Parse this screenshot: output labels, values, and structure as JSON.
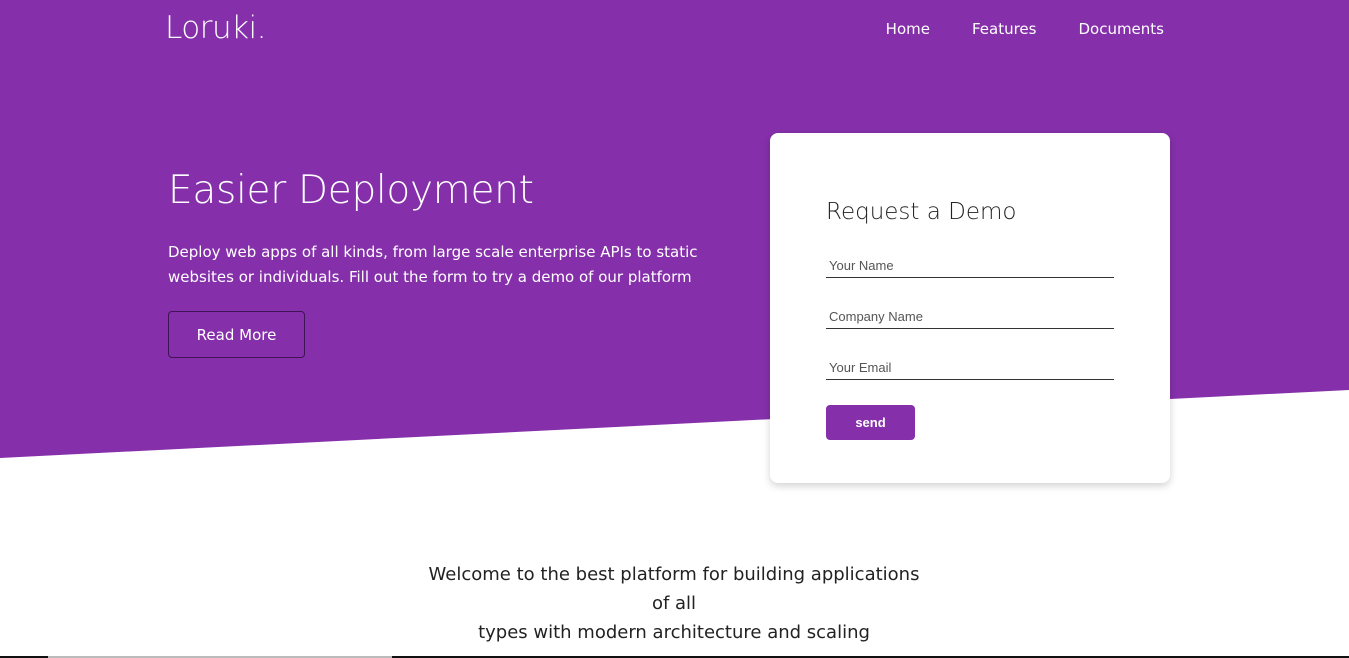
{
  "brand": {
    "logo": "Loruki."
  },
  "nav": {
    "items": [
      "Home",
      "Features",
      "Documents"
    ]
  },
  "hero": {
    "title": "Easier Deployment",
    "text": "Deploy web apps of all kinds, from large scale enterprise APIs to static websites or individuals. Fill out the form to try a demo of our platform",
    "button": "Read More"
  },
  "form": {
    "title": "Request a Demo",
    "name_placeholder": "Your Name",
    "company_placeholder": "Company Name",
    "email_placeholder": "Your Email",
    "submit": "send"
  },
  "welcome": {
    "line1": "Welcome to the best platform for building applications of all",
    "line2": "types with modern architecture and scaling"
  },
  "colors": {
    "primary": "#8530aa",
    "button_border": "#3f1355"
  }
}
